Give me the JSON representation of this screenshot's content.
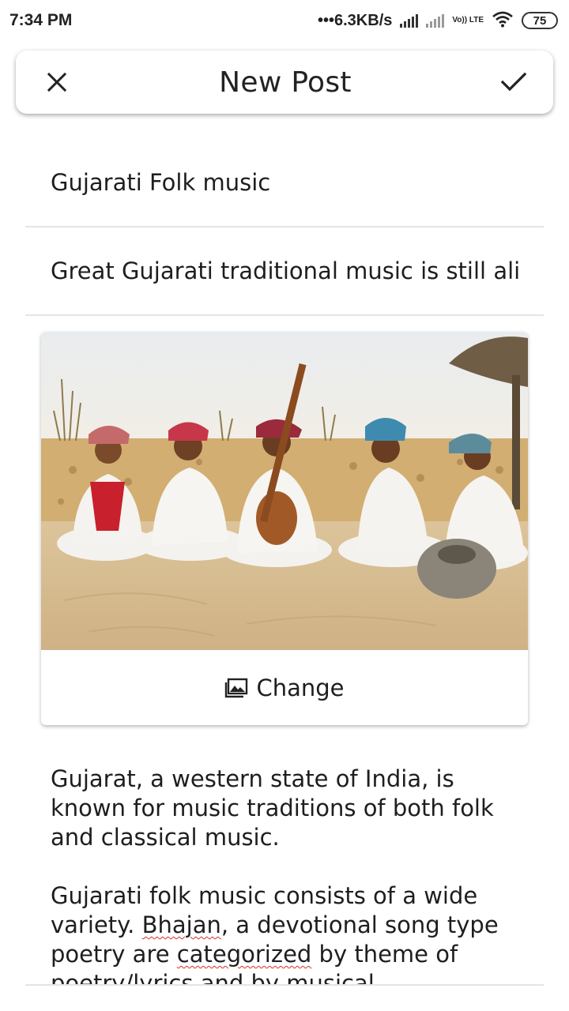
{
  "status_bar": {
    "time": "7:34 PM",
    "network_speed": "•••6.3KB/s",
    "volte": "Vo)) LTE",
    "battery": "75"
  },
  "appbar": {
    "title": "New Post",
    "close_icon": "close-icon",
    "confirm_icon": "check-icon"
  },
  "form": {
    "title_value": "Gujarati Folk music",
    "summary_value": "Great Gujarati traditional music is still alive"
  },
  "image_card": {
    "change_label": "Change",
    "change_icon": "image-icon"
  },
  "body": {
    "paragraph_1": "Gujarat, a western state of India, is known for music traditions of both folk and classical music.",
    "p2_part1": "Gujarati folk music consists of a wide variety. ",
    "p2_word1": "Bhajan",
    "p2_part2": ", a devotional song type poetry are ",
    "p2_word2": "categorized",
    "p2_part3": " by theme of poetry/lyrics and by musical"
  }
}
